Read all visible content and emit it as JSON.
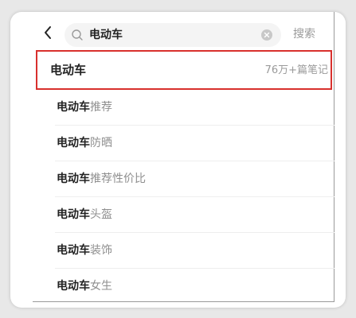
{
  "search": {
    "query": "电动车",
    "submit_label": "搜索"
  },
  "top_result": {
    "title": "电动车",
    "count": "76万+篇笔记"
  },
  "suggestions": [
    {
      "keyword": "电动车",
      "rest": "推荐"
    },
    {
      "keyword": "电动车",
      "rest": "防晒"
    },
    {
      "keyword": "电动车",
      "rest": "推荐性价比"
    },
    {
      "keyword": "电动车",
      "rest": "头盔"
    },
    {
      "keyword": "电动车",
      "rest": "装饰"
    },
    {
      "keyword": "电动车",
      "rest": "女生"
    }
  ],
  "colors": {
    "highlight_border": "#d8302d",
    "muted_text": "#9a9a9a",
    "primary_text": "#222222",
    "search_bg": "#f4f4f4"
  },
  "icons": {
    "back": "chevron-left-icon",
    "search": "search-icon",
    "clear": "clear-icon"
  }
}
